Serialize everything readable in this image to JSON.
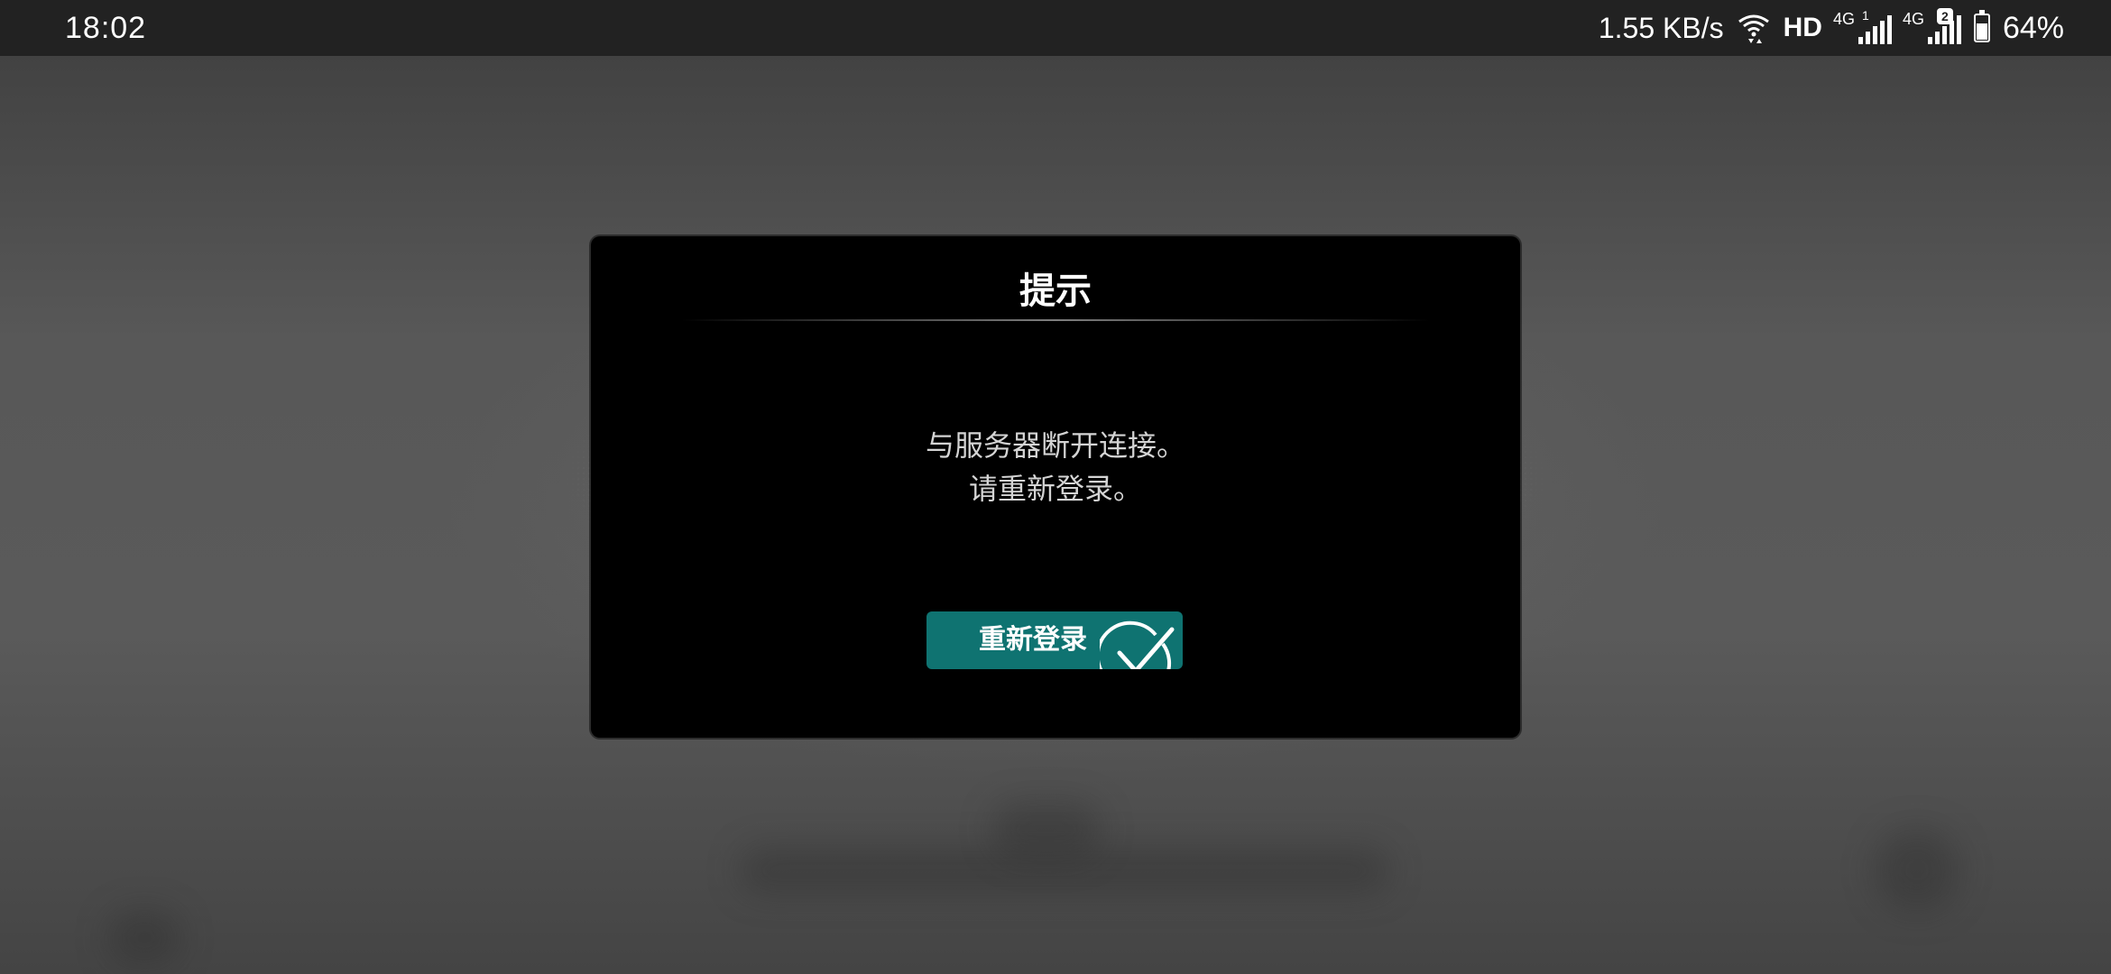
{
  "status_bar": {
    "time": "18:02",
    "net_speed": "1.55 KB/s",
    "hd": "HD",
    "sim1_network": "4G",
    "sim1_index": "1",
    "sim2_network": "4G",
    "sim2_index": "2",
    "battery": "64%",
    "battery_level": 0.64,
    "icons": [
      "wifi-icon",
      "signal-icon",
      "battery-icon"
    ]
  },
  "dialog": {
    "title": "提示",
    "message_line1": "与服务器断开连接。",
    "message_line2": "请重新登录。",
    "button_label": "重新登录",
    "button_color": "#0f7371",
    "button_icon": "check-icon"
  }
}
